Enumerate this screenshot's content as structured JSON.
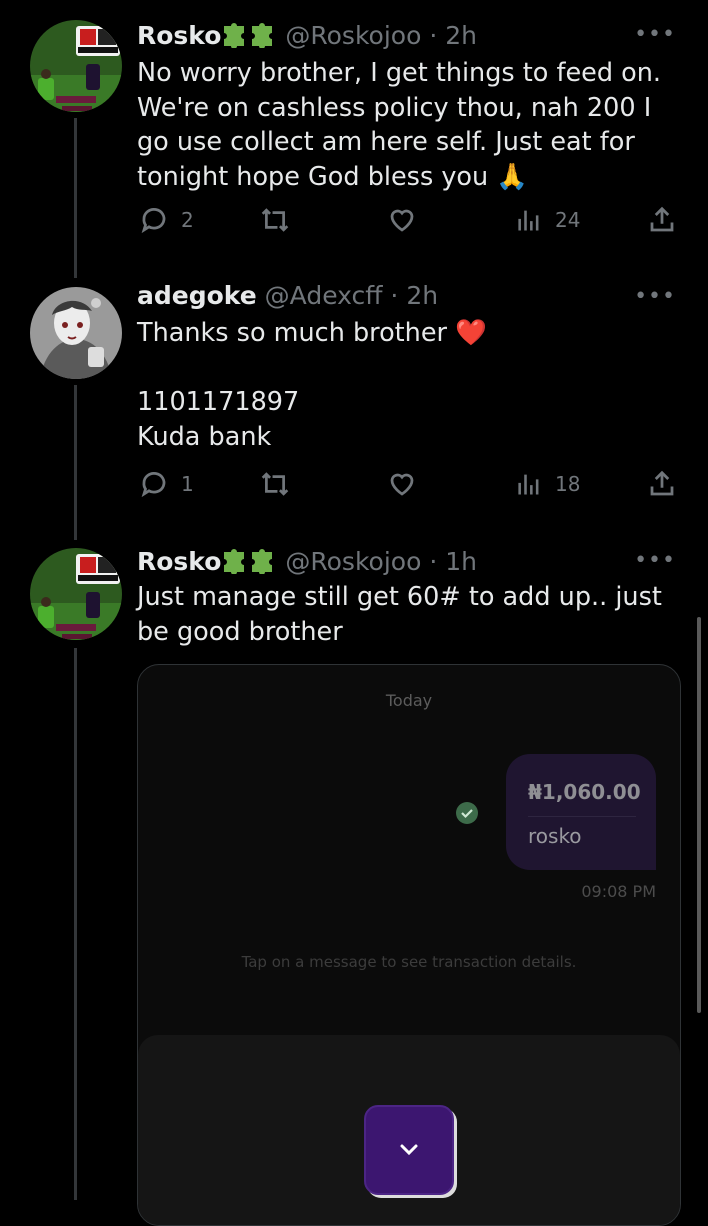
{
  "tweets": [
    {
      "name": "Rosko",
      "handle": "@Roskojoo",
      "time": "2h",
      "more": "•••",
      "text": "No worry brother, I get things to feed on. We're on cashless policy thou, nah 200 I go use collect am here self. Just eat for tonight hope God bless you 🙏",
      "replies": "2",
      "views": "24"
    },
    {
      "name": "adegoke",
      "handle": "@Adexcff",
      "time": "2h",
      "more": "•••",
      "text": "Thanks so much brother ❤️\n\n1101171897\nKuda bank",
      "replies": "1",
      "views": "18"
    },
    {
      "name": "Rosko",
      "handle": "@Roskojoo",
      "time": "1h",
      "more": "•••",
      "text": "Just manage still get 60# to add up.. just be good brother"
    }
  ],
  "embed": {
    "date_label": "Today",
    "amount": "₦1,060.00",
    "note": "rosko",
    "time": "09:08 PM",
    "hint": "Tap on a message to see transaction details."
  },
  "colors": {
    "background": "#000000",
    "text": "#e7e9ea",
    "muted": "#71767b",
    "bubble": "#1f1530",
    "accent_purple": "#3c1670"
  },
  "icons": [
    "reply-icon",
    "retweet-icon",
    "like-icon",
    "views-icon",
    "share-icon",
    "puzzle-icon",
    "check-icon",
    "chevron-down-icon"
  ]
}
